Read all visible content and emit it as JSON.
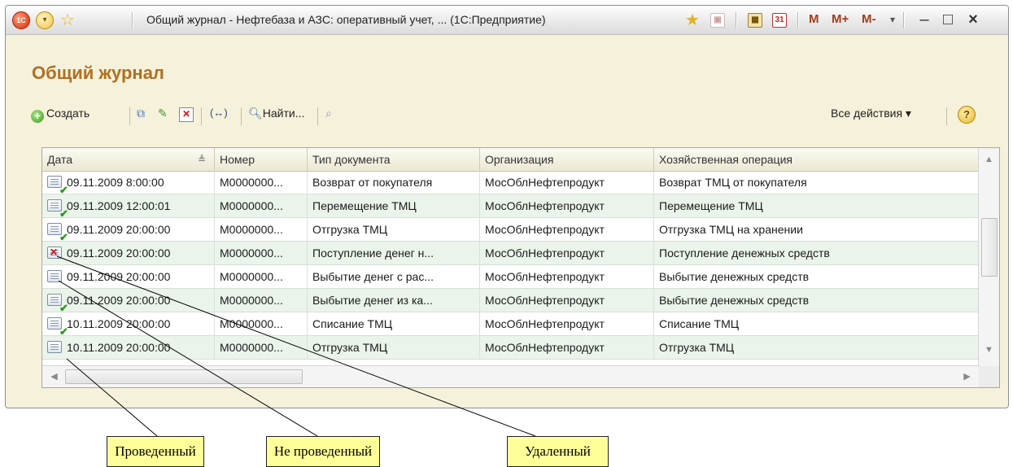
{
  "window": {
    "app_logo": "1С",
    "title": "Общий журнал - Нефтебаза и АЗС: оперативный учет, ... (1С:Предприятие)",
    "title_buttons": {
      "calendar": "31",
      "m": "M",
      "m_plus": "M+",
      "m_minus": "M-"
    },
    "controls": {
      "minimize": "–",
      "maximize": "□",
      "close": "×"
    }
  },
  "page": {
    "heading": "Общий журнал"
  },
  "toolbar": {
    "create_label": "Создать",
    "find_label": "Найти...",
    "all_actions_label": "Все действия ▾",
    "help_label": "?"
  },
  "table": {
    "columns": [
      "Дата",
      "Номер",
      "Тип документа",
      "Организация",
      "Хозяйственная операция"
    ],
    "rows": [
      {
        "status": "posted",
        "date": "09.11.2009 8:00:00",
        "number": "М0000000...",
        "doc_type": "Возврат от покупателя",
        "org": "МосОблНефтепродукт",
        "operation": "Возврат ТМЦ от покупателя"
      },
      {
        "status": "posted",
        "date": "09.11.2009 12:00:01",
        "number": "М0000000...",
        "doc_type": "Перемещение ТМЦ",
        "org": "МосОблНефтепродукт",
        "operation": "Перемещение ТМЦ"
      },
      {
        "status": "posted",
        "date": "09.11.2009 20:00:00",
        "number": "М0000000...",
        "doc_type": "Отгрузка ТМЦ",
        "org": "МосОблНефтепродукт",
        "operation": "Отгрузка ТМЦ на хранении"
      },
      {
        "status": "deleted",
        "date": "09.11.2009 20:00:00",
        "number": "М0000000...",
        "doc_type": "Поступление денег н...",
        "org": "МосОблНефтепродукт",
        "operation": "Поступление денежных средств"
      },
      {
        "status": "not_posted",
        "date": "09.11.2009 20:00:00",
        "number": "М0000000...",
        "doc_type": "Выбытие денег с рас...",
        "org": "МосОблНефтепродукт",
        "operation": "Выбытие денежных средств"
      },
      {
        "status": "posted",
        "date": "09.11.2009 20:00:00",
        "number": "М0000000...",
        "doc_type": "Выбытие денег из ка...",
        "org": "МосОблНефтепродукт",
        "operation": "Выбытие денежных средств"
      },
      {
        "status": "posted",
        "date": "10.11.2009 20:00:00",
        "number": "М0000000...",
        "doc_type": "Списание ТМЦ",
        "org": "МосОблНефтепродукт",
        "operation": "Списание ТМЦ"
      },
      {
        "status": "not_posted",
        "date": "10.11.2009 20:00:00",
        "number": "М0000000...",
        "doc_type": "Отгрузка ТМЦ",
        "org": "МосОблНефтепродукт",
        "operation": "Отгрузка ТМЦ"
      }
    ]
  },
  "callouts": [
    "Проведенный",
    "Не проведенный",
    "Удаленный"
  ]
}
